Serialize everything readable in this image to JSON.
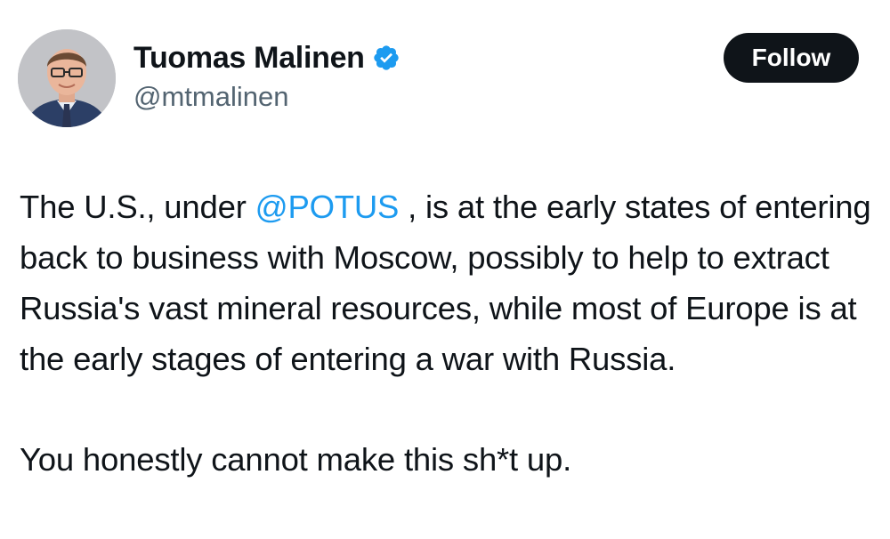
{
  "author": {
    "display_name": "Tuomas Malinen",
    "handle": "@mtmalinen",
    "verified": true,
    "verified_icon": "verified-badge-icon"
  },
  "follow_button": {
    "label": "Follow"
  },
  "tweet": {
    "part1_before": "The U.S., under ",
    "mention": "@POTUS",
    "part1_after": " , is at the early states of entering back to business with Moscow, possibly to help to extract Russia's vast mineral resources, while most of Europe is at the early stages of entering a war with Russia.",
    "part2": "You honestly cannot make this sh*t up."
  },
  "colors": {
    "link": "#1d9bf0",
    "verified": "#1d9bf0",
    "text": "#0f1419",
    "secondary": "#536471",
    "button_bg": "#0f1419"
  }
}
